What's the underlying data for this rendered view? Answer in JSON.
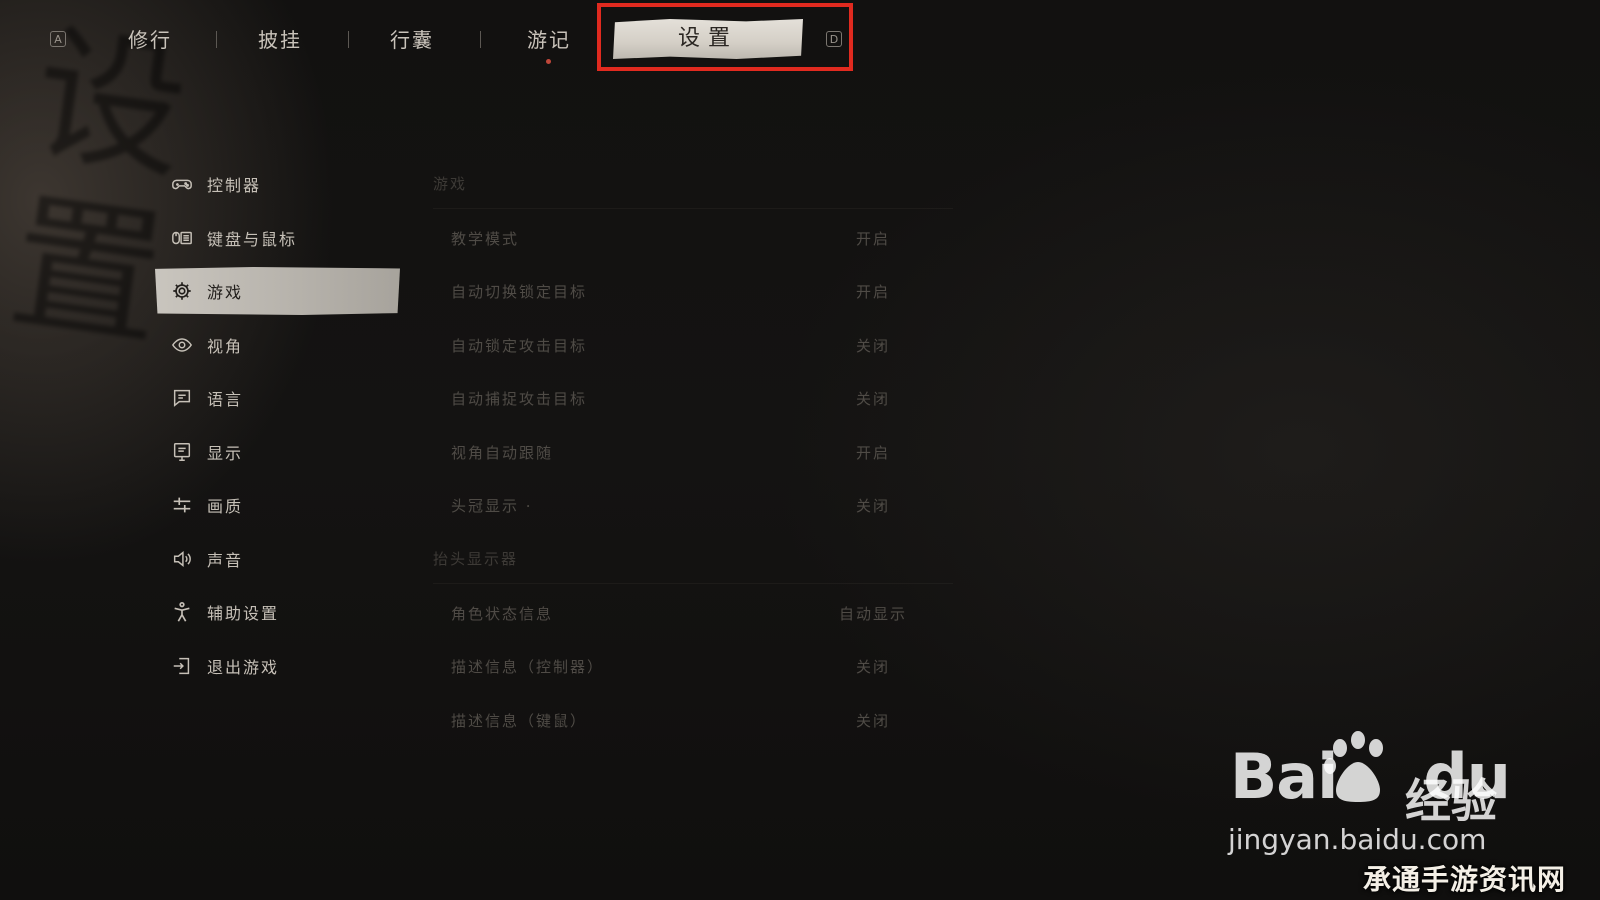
{
  "nav": {
    "left_key": "A",
    "right_key": "D",
    "tabs": [
      {
        "label": "修行"
      },
      {
        "label": "披挂"
      },
      {
        "label": "行囊"
      },
      {
        "label": "游记"
      },
      {
        "label": "设置"
      }
    ],
    "active_tab_index": 4,
    "highlight_color": "#e12a1f",
    "notification_dot_color": "#c0473a"
  },
  "sidebar": {
    "items": [
      {
        "label": "控制器",
        "icon": "controller-icon"
      },
      {
        "label": "键盘与鼠标",
        "icon": "keyboard-mouse-icon"
      },
      {
        "label": "游戏",
        "icon": "gear-icon"
      },
      {
        "label": "视角",
        "icon": "eye-icon"
      },
      {
        "label": "语言",
        "icon": "speech-bubble-icon"
      },
      {
        "label": "显示",
        "icon": "monitor-icon"
      },
      {
        "label": "画质",
        "icon": "sliders-icon"
      },
      {
        "label": "声音",
        "icon": "speaker-icon"
      },
      {
        "label": "辅助设置",
        "icon": "accessibility-icon"
      },
      {
        "label": "退出游戏",
        "icon": "exit-icon"
      }
    ],
    "active_index": 2
  },
  "settings": {
    "section_game": {
      "title": "游戏",
      "rows": [
        {
          "label": "教学模式",
          "value": "开启"
        },
        {
          "label": "自动切换锁定目标",
          "value": "开启"
        },
        {
          "label": "自动锁定攻击目标",
          "value": "关闭"
        },
        {
          "label": "自动捕捉攻击目标",
          "value": "关闭"
        },
        {
          "label": "视角自动跟随",
          "value": "开启"
        },
        {
          "label": "头冠显示 ·",
          "value": "关闭"
        }
      ]
    },
    "section_hud": {
      "title": "抬头显示器",
      "rows": [
        {
          "label": "角色状态信息",
          "value": "自动显示"
        },
        {
          "label": "描述信息（控制器）",
          "value": "关闭"
        },
        {
          "label": "描述信息（键鼠）",
          "value": "关闭"
        }
      ]
    }
  },
  "watermark": {
    "brand": "Bai",
    "brand_suffix": "du",
    "product": "经验",
    "url": "jingyan.baidu.com",
    "site": "承通手游资讯网"
  }
}
